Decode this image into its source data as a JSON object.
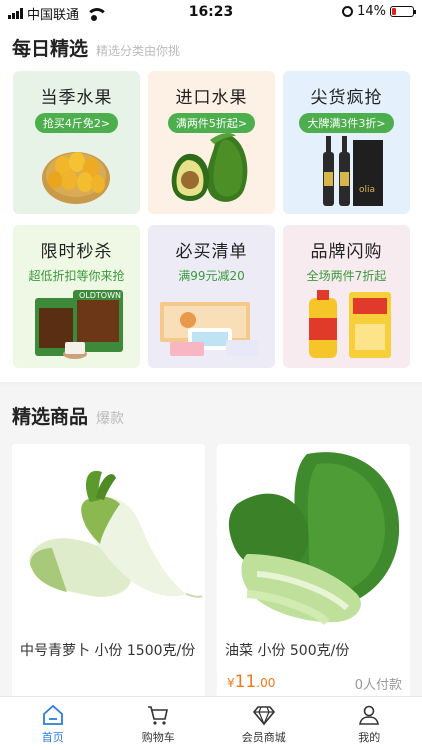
{
  "status_bar": {
    "carrier": "中国联通",
    "time": "16:23",
    "battery": "14%"
  },
  "daily": {
    "title": "每日精选",
    "subtitle": "精选分类由你挑",
    "cards": [
      {
        "title": "当季水果",
        "tag": "抢买4斤免2>",
        "icon": "mango-basket-icon",
        "bg": "#e8f3e8"
      },
      {
        "title": "进口水果",
        "tag": "满两件5折起>",
        "icon": "avocado-icon",
        "bg": "#fdf1e6"
      },
      {
        "title": "尖货疯抢",
        "tag": "大牌满3件3折>",
        "icon": "wine-bottles-icon",
        "bg": "#e4f0fb"
      },
      {
        "title": "限时秒杀",
        "tag": "超低折扣等你来抢",
        "icon": "coffee-bags-icon",
        "bg": "#eef8e4"
      },
      {
        "title": "必买清单",
        "tag": "满99元减20",
        "icon": "tissue-box-icon",
        "bg": "#ecebf6"
      },
      {
        "title": "品牌闪购",
        "tag": "全场两件7折起",
        "icon": "oil-rice-icon",
        "bg": "#f7ebf0"
      }
    ]
  },
  "featured": {
    "title": "精选商品",
    "subtitle": "爆款",
    "products": [
      {
        "name": "中号青萝卜 小份 1500克/份",
        "price": "",
        "paid": "",
        "icon": "radish-icon"
      },
      {
        "name": "油菜 小份 500克/份",
        "price_symbol": "¥",
        "price_int": "11",
        "price_dec": ".00",
        "paid": "0人付款",
        "icon": "bok-choy-icon"
      }
    ]
  },
  "tabs": [
    {
      "label": "首页",
      "icon": "home-icon",
      "active": true
    },
    {
      "label": "购物车",
      "icon": "cart-icon",
      "active": false
    },
    {
      "label": "会员商城",
      "icon": "diamond-icon",
      "active": false
    },
    {
      "label": "我的",
      "icon": "user-icon",
      "active": false
    }
  ],
  "colors": {
    "accent": "#2a7de1",
    "tag_green": "#4cae4c",
    "price_orange": "#f07a1a"
  }
}
